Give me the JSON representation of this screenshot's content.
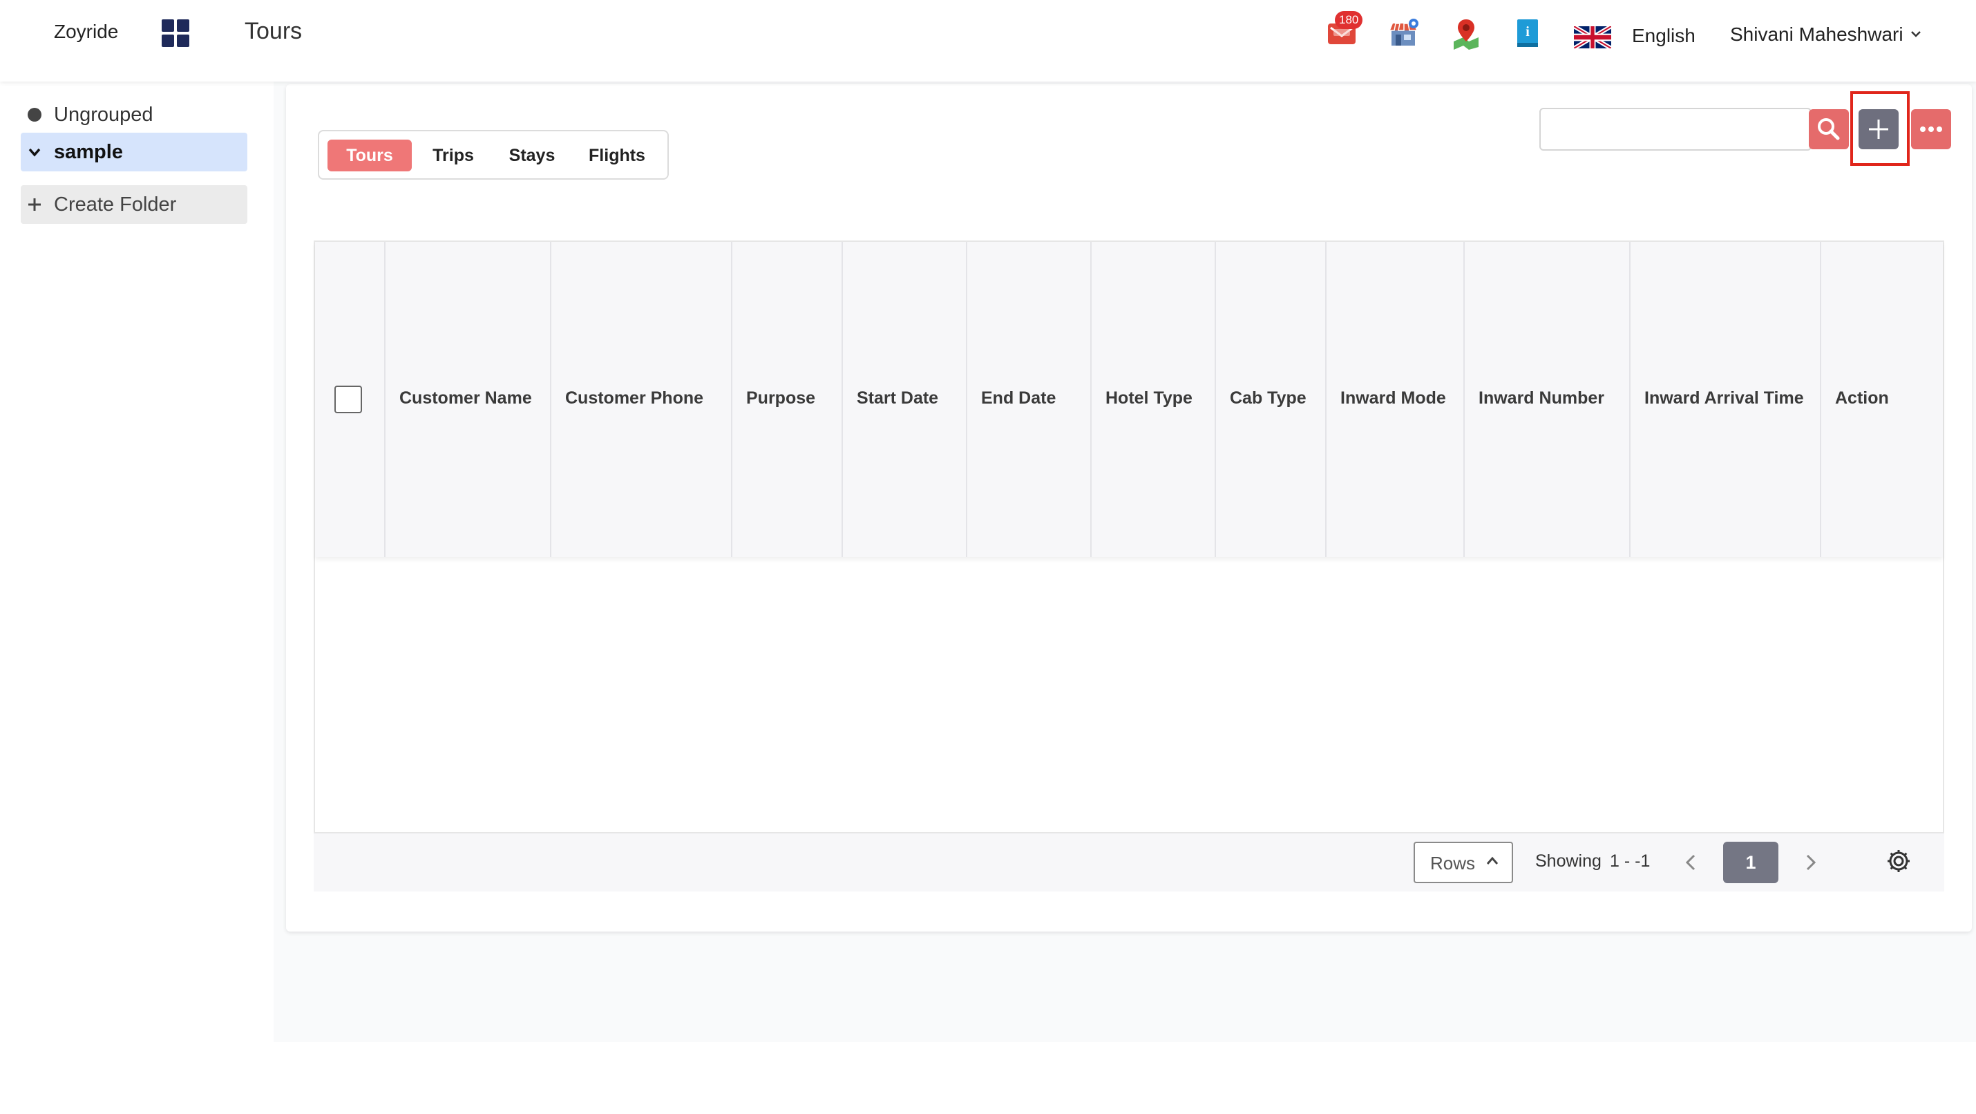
{
  "app": {
    "name": "Zoyride",
    "page_title": "Tours"
  },
  "header": {
    "notifications_count": "180",
    "language": "English",
    "user_name": "Shivani Maheshwari",
    "icons": [
      "apps-grid-icon",
      "mail-notification-icon",
      "store-icon",
      "map-pin-icon",
      "info-book-icon",
      "uk-flag-icon",
      "chevron-down-icon"
    ]
  },
  "sidebar": {
    "items": [
      {
        "label": "Ungrouped",
        "icon": "dot-icon"
      },
      {
        "label": "sample",
        "icon": "chevron-down-icon",
        "active": true
      }
    ],
    "create_folder": "Create Folder"
  },
  "tabs": [
    {
      "label": "Tours",
      "active": true
    },
    {
      "label": "Trips"
    },
    {
      "label": "Stays"
    },
    {
      "label": "Flights"
    }
  ],
  "search": {
    "value": "",
    "placeholder": ""
  },
  "table": {
    "columns": [
      "Customer Name",
      "Customer Phone",
      "Purpose",
      "Start Date",
      "End Date",
      "Hotel Type",
      "Cab Type",
      "Inward Mode",
      "Inward Number",
      "Inward Arrival Time",
      "Action"
    ],
    "rows": []
  },
  "pagination": {
    "rows_label": "Rows",
    "showing_label": "Showing",
    "range": "1 - -1",
    "current_page": "1"
  },
  "colors": {
    "accent_red": "#e56b6b",
    "tab_active": "#ef7777",
    "add_button": "#6e6f7e",
    "highlight_box": "#e0261b",
    "active_folder": "#d6e4fc",
    "badge": "#e03131"
  }
}
